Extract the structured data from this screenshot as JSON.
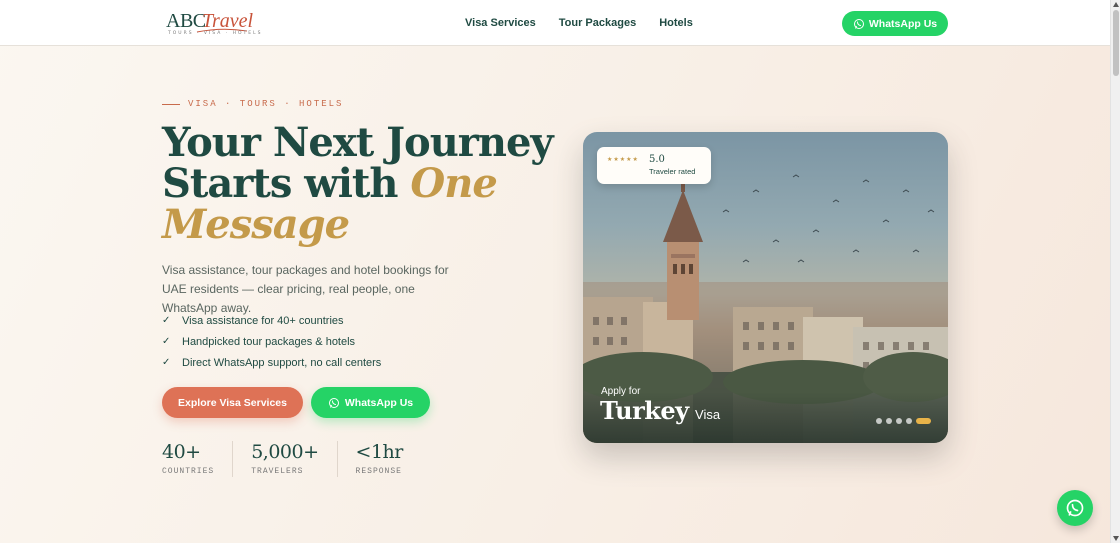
{
  "logo": {
    "abc": "ABC",
    "travel": "Travel",
    "tagline": "TOURS · VISA · HOTELS"
  },
  "nav": {
    "links": [
      "Visa Services",
      "Tour Packages",
      "Hotels"
    ],
    "cta": "WhatsApp Us"
  },
  "hero": {
    "eyebrow": "VISA · TOURS · HOTELS",
    "title_line1": "Your Next Journey",
    "title_line2": "Starts with ",
    "title_accent": "One Message",
    "subtitle": "Visa assistance, tour packages and hotel bookings for UAE residents — clear pricing, real people, one WhatsApp away.",
    "features": [
      "Visa assistance for 40+ countries",
      "Handpicked tour packages & hotels",
      "Direct WhatsApp support, no call centers"
    ],
    "check_icon": "✓",
    "primary_button": "Explore Visa Services",
    "secondary_button": "WhatsApp Us",
    "stats": [
      {
        "value": "40+",
        "label": "COUNTRIES"
      },
      {
        "value": "5,000+",
        "label": "TRAVELERS"
      },
      {
        "value": "<1hr",
        "label": "RESPONSE"
      }
    ]
  },
  "card": {
    "stars": "★★★★★",
    "score": "5.0",
    "score_label": "Traveler rated",
    "apply_label": "Apply for",
    "country": "Turkey",
    "visa_label": "Visa",
    "slides": 5,
    "active_slide": 5
  },
  "colors": {
    "primary": "#1f4a42",
    "accent_gold": "#c49a4a",
    "coral": "#de7256",
    "whatsapp": "#25d366"
  },
  "icons": [
    "whatsapp-icon",
    "check-icon",
    "star-icon"
  ]
}
